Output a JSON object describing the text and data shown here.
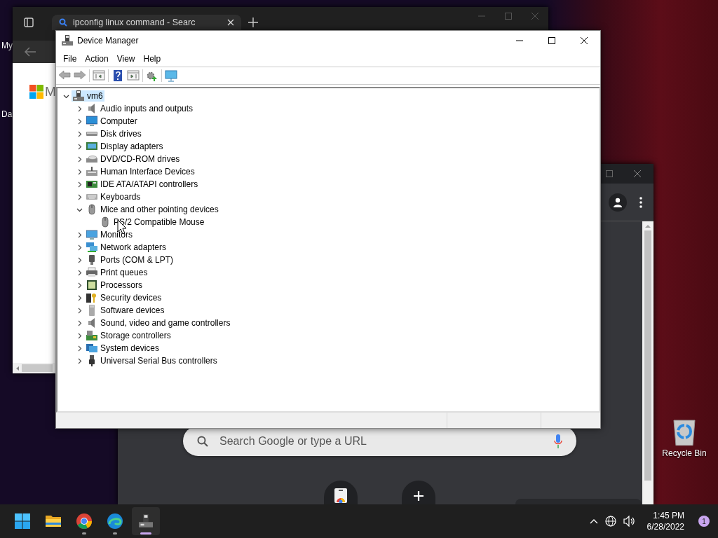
{
  "desktop": {
    "icons": [
      {
        "label": "My"
      },
      {
        "label": "Da"
      },
      {
        "label": "Recycle Bin"
      }
    ]
  },
  "browser_back": {
    "tab": {
      "title": "ipconfig linux command - Searc",
      "selected": true
    },
    "page": {
      "logo_text": "M"
    }
  },
  "browser_front": {
    "search": {
      "placeholder": "Search Google or type a URL"
    }
  },
  "device_manager": {
    "title": "Device Manager",
    "menu": [
      "File",
      "Action",
      "View",
      "Help"
    ],
    "tree": {
      "label": "vm6",
      "expanded": true,
      "selected": true,
      "children": [
        {
          "label": "Audio inputs and outputs",
          "expanded": false,
          "selected": false
        },
        {
          "label": "Computer",
          "expanded": false,
          "selected": false
        },
        {
          "label": "Disk drives",
          "expanded": false,
          "selected": false
        },
        {
          "label": "Display adapters",
          "expanded": false,
          "selected": false
        },
        {
          "label": "DVD/CD-ROM drives",
          "expanded": false,
          "selected": false
        },
        {
          "label": "Human Interface Devices",
          "expanded": false,
          "selected": false
        },
        {
          "label": "IDE ATA/ATAPI controllers",
          "expanded": false,
          "selected": false
        },
        {
          "label": "Keyboards",
          "expanded": false,
          "selected": false
        },
        {
          "label": "Mice and other pointing devices",
          "expanded": true,
          "selected": false,
          "children": [
            {
              "label": "PS/2 Compatible Mouse",
              "selected": false
            }
          ]
        },
        {
          "label": "Monitors",
          "expanded": false,
          "selected": false
        },
        {
          "label": "Network adapters",
          "expanded": false,
          "selected": false
        },
        {
          "label": "Ports (COM & LPT)",
          "expanded": false,
          "selected": false
        },
        {
          "label": "Print queues",
          "expanded": false,
          "selected": false
        },
        {
          "label": "Processors",
          "expanded": false,
          "selected": false
        },
        {
          "label": "Security devices",
          "expanded": false,
          "selected": false
        },
        {
          "label": "Software devices",
          "expanded": false,
          "selected": false
        },
        {
          "label": "Sound, video and game controllers",
          "expanded": false,
          "selected": false
        },
        {
          "label": "Storage controllers",
          "expanded": false,
          "selected": false
        },
        {
          "label": "System devices",
          "expanded": false,
          "selected": false
        },
        {
          "label": "Universal Serial Bus controllers",
          "expanded": false,
          "selected": false
        }
      ]
    }
  },
  "taskbar": {
    "apps": [
      {
        "running": false,
        "selected": false
      },
      {
        "running": true,
        "selected": false
      },
      {
        "running": true,
        "selected": false
      },
      {
        "running": true,
        "selected": true
      }
    ],
    "time": "1:45 PM",
    "date": "6/28/2022",
    "notifications": "1"
  }
}
